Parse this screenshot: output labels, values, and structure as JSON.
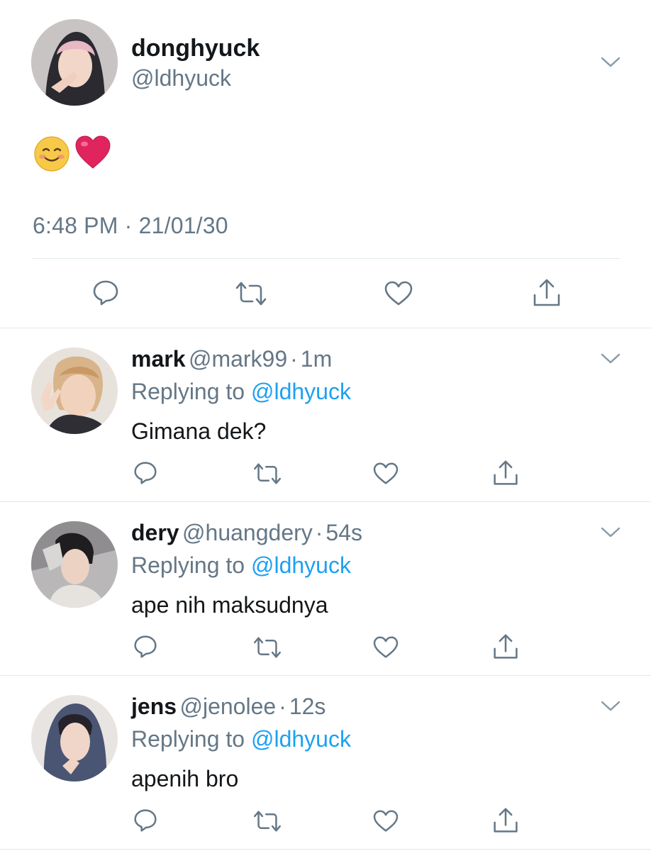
{
  "main_tweet": {
    "display_name": "donghyuck",
    "handle": "@ldhyuck",
    "body_emoji": "☺️❤️",
    "timestamp": "6:48 PM · 21/01/30",
    "actions": [
      "reply-icon",
      "retweet-icon",
      "like-icon",
      "share-icon"
    ]
  },
  "replies": [
    {
      "display_name": "mark",
      "handle": "@mark99",
      "separator": "·",
      "age": "1m",
      "replying_prefix": "Replying to",
      "replying_to": "@ldhyuck",
      "text": "Gimana dek?"
    },
    {
      "display_name": "dery",
      "handle": "@huangdery",
      "separator": "·",
      "age": "54s",
      "replying_prefix": "Replying to",
      "replying_to": "@ldhyuck",
      "text": "ape nih maksudnya"
    },
    {
      "display_name": "jens",
      "handle": "@jenolee",
      "separator": "·",
      "age": "12s",
      "replying_prefix": "Replying to",
      "replying_to": "@ldhyuck",
      "text": "apenih bro"
    }
  ],
  "colors": {
    "text": "#14171a",
    "secondary": "#657786",
    "link": "#1da1f2",
    "divider": "#e1e8ed",
    "heart": "#e0245e",
    "smiley": "#f7c948"
  }
}
